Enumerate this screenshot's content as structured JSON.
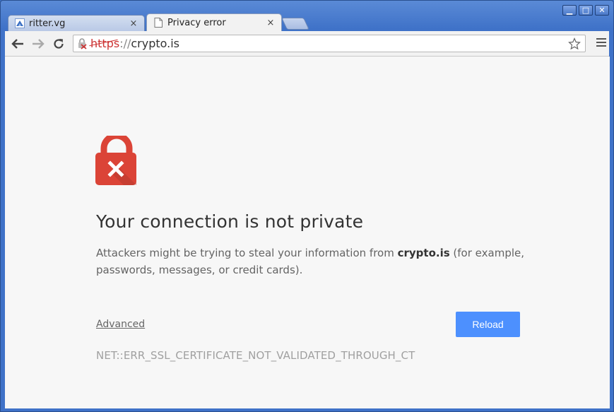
{
  "window": {
    "minimize": "▁",
    "maximize": "□",
    "close": "✕"
  },
  "tabs": [
    {
      "label": "ritter.vg",
      "close": "×",
      "icon": "ritter-favicon"
    },
    {
      "label": "Privacy error",
      "close": "×",
      "icon": "page-icon"
    }
  ],
  "toolbar": {
    "back_icon": "back-arrow-icon",
    "forward_icon": "forward-arrow-icon",
    "reload_icon": "reload-icon",
    "url_scheme": "https",
    "url_sep": "://",
    "url_host": "crypto.is",
    "star_icon": "star-icon",
    "menu_icon": "hamburger-menu-icon"
  },
  "page": {
    "heading": "Your connection is not private",
    "desc_prefix": "Attackers might be trying to steal your information from ",
    "desc_host": "crypto.is",
    "desc_suffix": " (for example, passwords, messages, or credit cards).",
    "advanced_link": "Advanced",
    "reload_button": "Reload",
    "error_code": "NET::ERR_SSL_CERTIFICATE_NOT_VALIDATED_THROUGH_CT"
  },
  "colors": {
    "accent": "#4d90fe",
    "lock_red": "#db4437",
    "window_frame": "#3f72c8"
  }
}
